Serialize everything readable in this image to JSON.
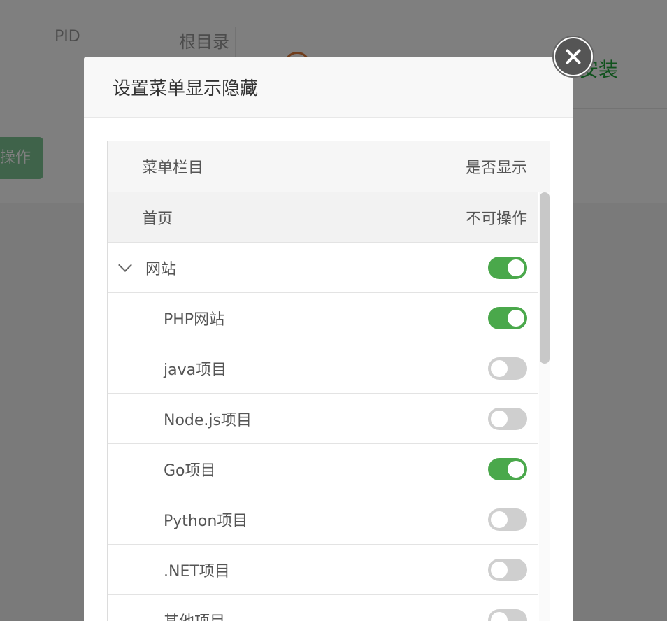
{
  "background": {
    "col_pid": "PID",
    "col_root": "根目录",
    "card_text": "安装",
    "op_button": "操作"
  },
  "modal": {
    "title": "设置菜单显示隐藏",
    "table": {
      "header": {
        "col_menu": "菜单栏目",
        "col_show": "是否显示"
      },
      "home_row": {
        "label": "首页",
        "status": "不可操作"
      },
      "rows": [
        {
          "label": "网站",
          "type": "parent",
          "enabled": true,
          "expanded": true
        },
        {
          "label": "PHP网站",
          "type": "child",
          "enabled": true
        },
        {
          "label": "java项目",
          "type": "child",
          "enabled": false
        },
        {
          "label": "Node.js项目",
          "type": "child",
          "enabled": false
        },
        {
          "label": "Go项目",
          "type": "child",
          "enabled": true
        },
        {
          "label": "Python项目",
          "type": "child",
          "enabled": false
        },
        {
          "label": ".NET项目",
          "type": "child",
          "enabled": false
        },
        {
          "label": "其他项目",
          "type": "child",
          "enabled": false
        }
      ]
    }
  },
  "colors": {
    "accent_green": "#4aa84b",
    "toggle_off": "#cfcfcf"
  },
  "icons": {
    "close": "close-icon",
    "expand": "chevron-down-icon"
  }
}
